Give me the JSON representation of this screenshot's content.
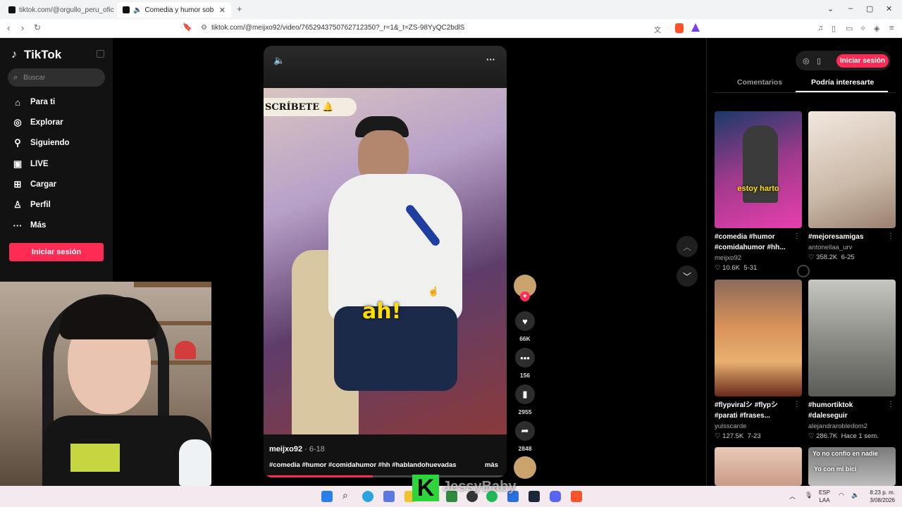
{
  "browser": {
    "tabs": [
      {
        "title": "tiktok.com/@orgullo_peru_oficial/vid",
        "active": false
      },
      {
        "title": "Comedia y humor sobre com",
        "active": true
      }
    ],
    "new_tab": "+",
    "url": "tiktok.com/@meijxo92/video/7652943750762712350?_r=1&_t=ZS-98YyQC2bdlS"
  },
  "tiktok": {
    "logo": "TikTok",
    "search_placeholder": "Buscar",
    "nav": [
      {
        "label": "Para ti",
        "icon": "home-icon"
      },
      {
        "label": "Explorar",
        "icon": "compass-icon"
      },
      {
        "label": "Siguiendo",
        "icon": "following-icon"
      },
      {
        "label": "LIVE",
        "icon": "live-icon"
      },
      {
        "label": "Cargar",
        "icon": "upload-icon"
      },
      {
        "label": "Perfil",
        "icon": "profile-icon"
      },
      {
        "label": "Más",
        "icon": "more-icon"
      }
    ],
    "login_label": "Iniciar sesión"
  },
  "video": {
    "overlay_banner": "SCRÍBETE",
    "caption_overlay": "ah!",
    "author": "meijxo92",
    "date": "6-18",
    "tags": "#comedia #humor #comidahumor #hh #hablandohuevadas",
    "more_label": "más",
    "progress": 0.45,
    "actions": {
      "likes": "66K",
      "comments": "156",
      "saves": "2955",
      "shares": "2848"
    }
  },
  "right_panel": {
    "login_label": "Iniciar sesión",
    "tabs": [
      {
        "label": "Comentarios",
        "active": false
      },
      {
        "label": "Podría interesarte",
        "active": true
      }
    ],
    "cards": [
      {
        "title": "#comedia #humor #comidahumor #hh...",
        "author": "meijxo92",
        "likes": "10.6K",
        "date": "5-31",
        "overlay": "estoy harto"
      },
      {
        "title": "#mejoresamigas",
        "author": "antonellaa_urv",
        "likes": "358.2K",
        "date": "6-25",
        "overlay": ""
      },
      {
        "title": "#flypviralシ #flypシ #parati #frases...",
        "author": "yulsscarde",
        "likes": "127.5K",
        "date": "7-23",
        "overlay": ""
      },
      {
        "title": "#humortiktok #daleseguir",
        "author": "alejandrarobledom2",
        "likes": "286.7K",
        "date": "Hace 1 sem.",
        "overlay": ""
      },
      {
        "title": "",
        "author": "",
        "likes": "",
        "date": "",
        "overlay": ""
      },
      {
        "title": "",
        "author": "",
        "likes": "",
        "date": "",
        "overlay": "Yo no confío en nadie"
      }
    ],
    "card6_sub": "Yo con mi bici"
  },
  "stream_overlay": {
    "k_logo": "K",
    "name": "JessyBaby"
  },
  "taskbar": {
    "lang1": "ESP",
    "lang2": "LAA",
    "time": "8:23 p. m.",
    "date": "3/08/2026"
  },
  "colors": {
    "tiktok_pink": "#fe2c55",
    "sidebar_bg": "#121212"
  }
}
